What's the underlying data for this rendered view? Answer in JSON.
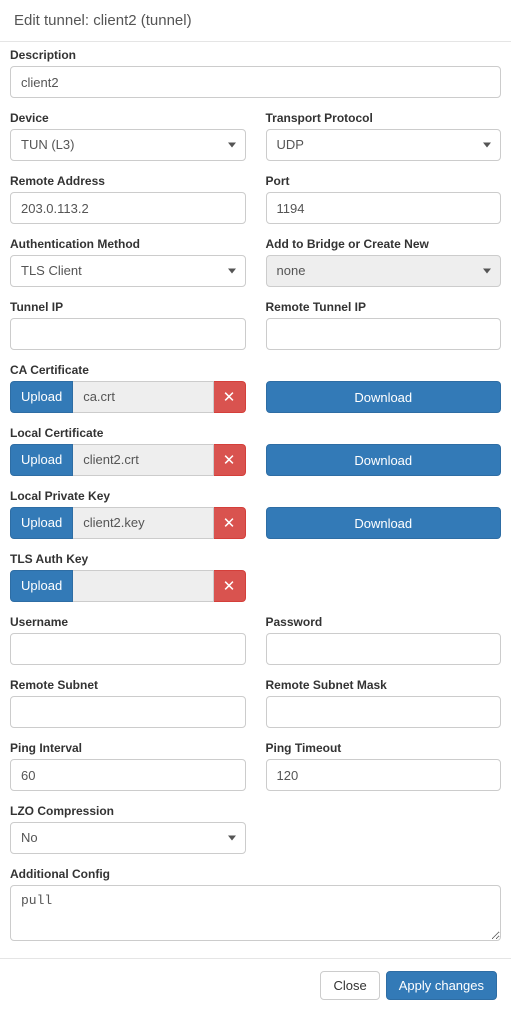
{
  "header": {
    "title": "Edit tunnel: client2 (tunnel)"
  },
  "labels": {
    "description": "Description",
    "device": "Device",
    "transport_protocol": "Transport Protocol",
    "remote_address": "Remote Address",
    "port": "Port",
    "auth_method": "Authentication Method",
    "bridge": "Add to Bridge or Create New",
    "tunnel_ip": "Tunnel IP",
    "remote_tunnel_ip": "Remote Tunnel IP",
    "ca_cert": "CA Certificate",
    "local_cert": "Local Certificate",
    "local_key": "Local Private Key",
    "tls_auth_key": "TLS Auth Key",
    "username": "Username",
    "password": "Password",
    "remote_subnet": "Remote Subnet",
    "remote_subnet_mask": "Remote Subnet Mask",
    "ping_interval": "Ping Interval",
    "ping_timeout": "Ping Timeout",
    "lzo": "LZO Compression",
    "additional_config": "Additional Config"
  },
  "values": {
    "description": "client2",
    "device": "TUN (L3)",
    "transport_protocol": "UDP",
    "remote_address": "203.0.113.2",
    "port": "1194",
    "auth_method": "TLS Client",
    "bridge": "none",
    "tunnel_ip": "",
    "remote_tunnel_ip": "",
    "ca_cert_file": "ca.crt",
    "local_cert_file": "client2.crt",
    "local_key_file": "client2.key",
    "tls_auth_file": "",
    "username": "",
    "password": "",
    "remote_subnet": "",
    "remote_subnet_mask": "",
    "ping_interval": "60",
    "ping_timeout": "120",
    "lzo": "No",
    "additional_config": "pull"
  },
  "buttons": {
    "upload": "Upload",
    "download": "Download",
    "close": "Close",
    "apply": "Apply changes"
  }
}
